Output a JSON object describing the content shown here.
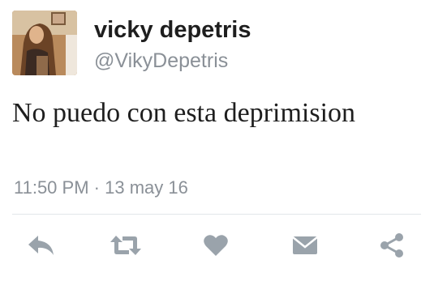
{
  "tweet": {
    "display_name": "vicky depetris",
    "handle": "@VikyDepetris",
    "text": "No puedo con esta deprimision",
    "timestamp": "11:50 PM",
    "separator": "·",
    "date": "13 may 16"
  },
  "actions": [
    {
      "icon": "reply-icon"
    },
    {
      "icon": "retweet-icon"
    },
    {
      "icon": "heart-icon"
    },
    {
      "icon": "direct-message-icon"
    },
    {
      "icon": "share-icon"
    }
  ],
  "colors": {
    "icon": "#9aa3ab",
    "text": "#1e1e1e",
    "muted": "#8a9097",
    "divider": "#e1e6ea"
  }
}
